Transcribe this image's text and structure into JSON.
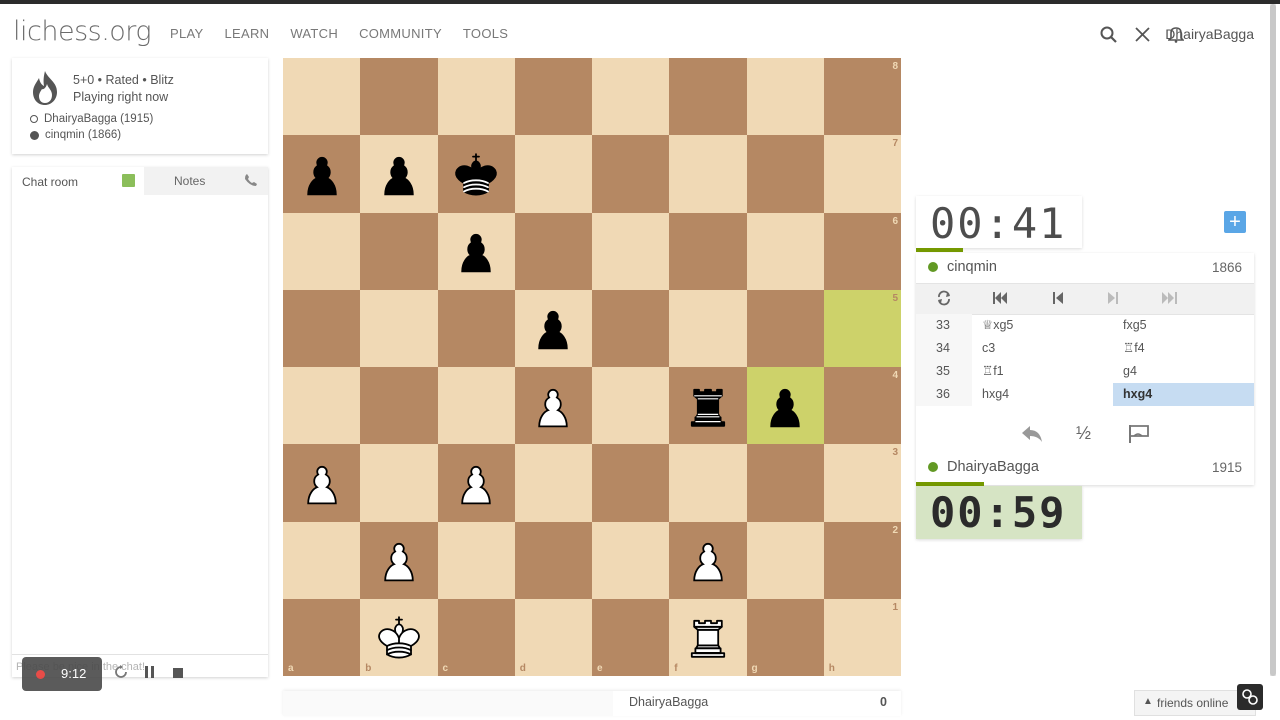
{
  "header": {
    "logo": "lichess.org",
    "nav": [
      "PLAY",
      "LEARN",
      "WATCH",
      "COMMUNITY",
      "TOOLS"
    ],
    "username": "DhairyaBagga"
  },
  "game_info": {
    "line1": "5+0 • Rated • Blitz",
    "line2": "Playing right now",
    "white_player": "DhairyaBagga (1915)",
    "black_player": "cinqmin (1866)"
  },
  "chat": {
    "tab_chat": "Chat room",
    "tab_notes": "Notes",
    "placeholder": "Please be nice in the chat!"
  },
  "recorder": {
    "time": "9:12"
  },
  "board": {
    "files": [
      "a",
      "b",
      "c",
      "d",
      "e",
      "f",
      "g",
      "h"
    ],
    "ranks": [
      "8",
      "7",
      "6",
      "5",
      "4",
      "3",
      "2",
      "1"
    ],
    "highlight": [
      "g4",
      "h5"
    ],
    "pieces": [
      {
        "sq": "a7",
        "p": "bp"
      },
      {
        "sq": "b7",
        "p": "bp"
      },
      {
        "sq": "c7",
        "p": "bk"
      },
      {
        "sq": "c6",
        "p": "bp"
      },
      {
        "sq": "d5",
        "p": "bp"
      },
      {
        "sq": "d4",
        "p": "wp"
      },
      {
        "sq": "f4",
        "p": "br"
      },
      {
        "sq": "g4",
        "p": "bp"
      },
      {
        "sq": "a3",
        "p": "wp"
      },
      {
        "sq": "c3",
        "p": "wp"
      },
      {
        "sq": "b2",
        "p": "wp"
      },
      {
        "sq": "f2",
        "p": "wp"
      },
      {
        "sq": "b1",
        "p": "wk"
      },
      {
        "sq": "f1",
        "p": "wr"
      }
    ]
  },
  "board_bottom": {
    "player": "DhairyaBagga",
    "score": "0"
  },
  "clocks": {
    "top": "00:41",
    "bottom": "00:59",
    "top_fraction": 0.14,
    "bottom_fraction": 0.2
  },
  "players": {
    "top": {
      "name": "cinqmin",
      "rating": "1866"
    },
    "bottom": {
      "name": "DhairyaBagga",
      "rating": "1915"
    }
  },
  "moves": [
    {
      "num": "33",
      "white": "♕xg5",
      "black": "fxg5"
    },
    {
      "num": "34",
      "white": "c3",
      "black": "♖f4"
    },
    {
      "num": "35",
      "white": "♖f1",
      "black": "g4"
    },
    {
      "num": "36",
      "white": "hxg4",
      "black": "hxg4"
    }
  ],
  "controls": {
    "draw": "½"
  },
  "friends": {
    "label": "friends online"
  }
}
